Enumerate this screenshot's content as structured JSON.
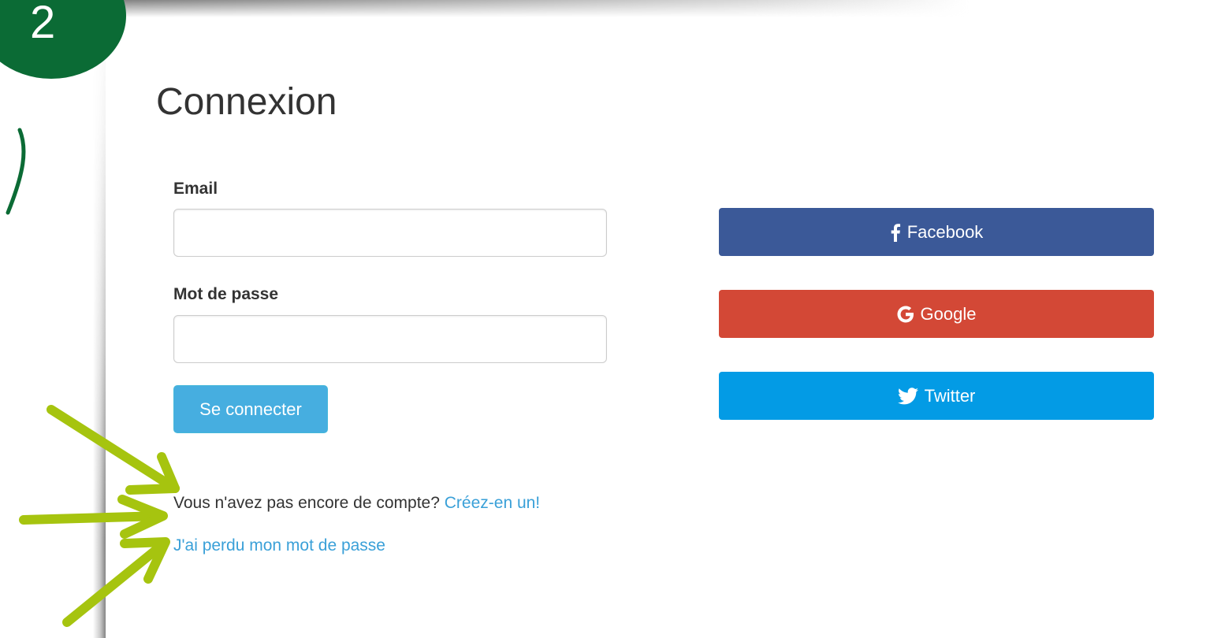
{
  "step": {
    "number": "2",
    "color": "#0b6b35"
  },
  "page": {
    "title": "Connexion"
  },
  "form": {
    "email_label": "Email",
    "email_value": "",
    "password_label": "Mot de passe",
    "password_value": "",
    "submit_label": "Se connecter",
    "submit_color": "#46aee0"
  },
  "links": {
    "signup_prompt": "Vous n'avez pas encore de compte?",
    "signup_link": "Créez-en un!",
    "forgot_password": "J'ai perdu mon mot de passe",
    "link_color": "#3aa0d8"
  },
  "social": [
    {
      "label": "Facebook",
      "icon": "facebook-icon",
      "color": "#3b5998"
    },
    {
      "label": "Google",
      "icon": "google-icon",
      "color": "#d34836"
    },
    {
      "label": "Twitter",
      "icon": "twitter-icon",
      "color": "#039be5"
    }
  ],
  "annotation": {
    "arrow_color": "#a6c40f",
    "stroke_color": "#0b6b35"
  }
}
